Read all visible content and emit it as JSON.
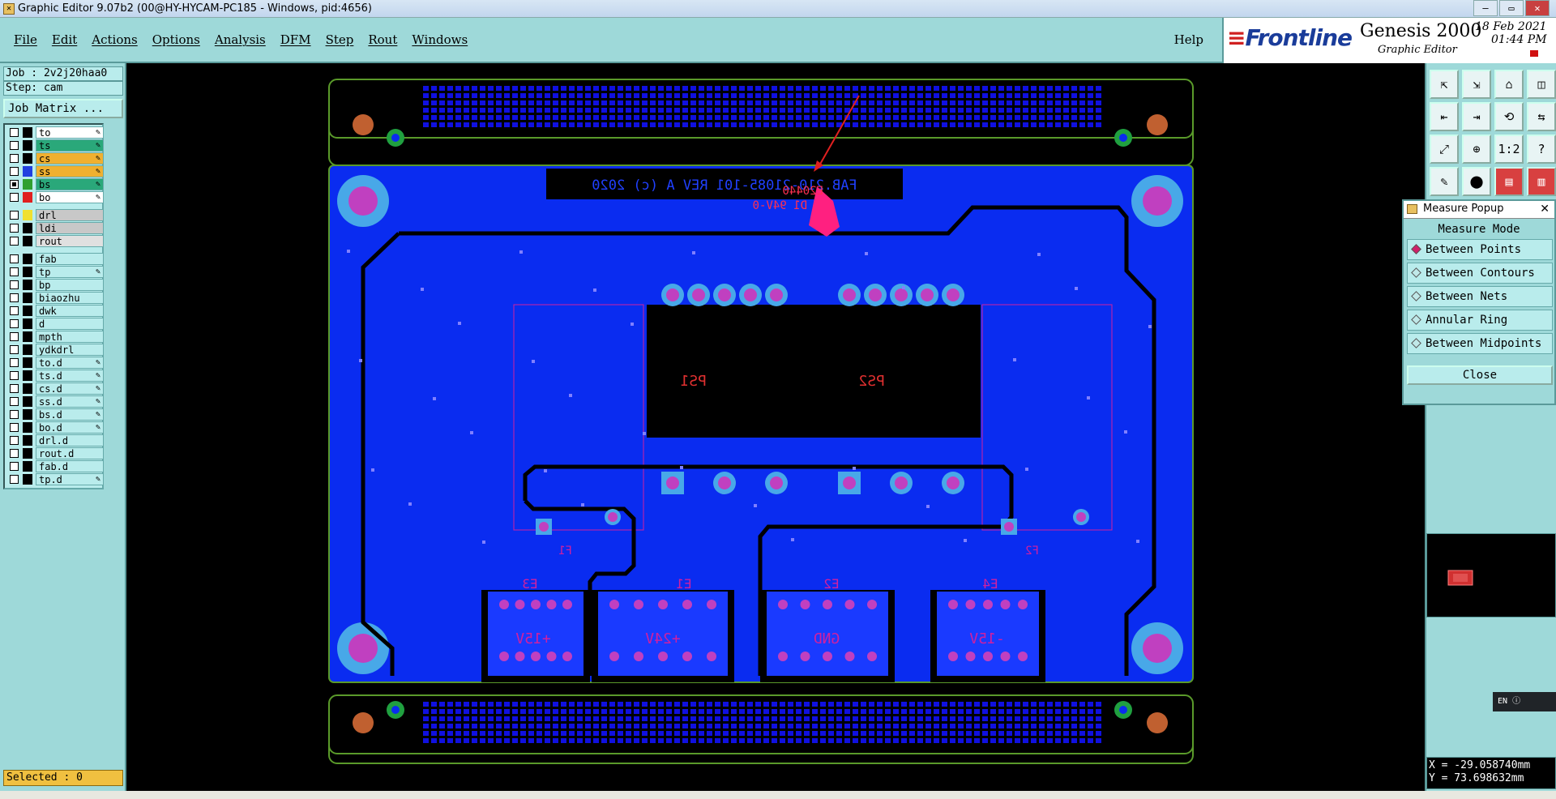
{
  "window": {
    "title": "Graphic Editor 9.07b2 (00@HY-HYCAM-PC185 - Windows, pid:4656)",
    "minimize_glyph": "—",
    "maximize_glyph": "▭",
    "close_glyph": "✕"
  },
  "menu": {
    "items": [
      "File",
      "Edit",
      "Actions",
      "Options",
      "Analysis",
      "DFM",
      "Step",
      "Rout",
      "Windows"
    ],
    "help": "Help"
  },
  "brand": {
    "logo": "Frontline",
    "product": "Genesis 2000",
    "subtitle": "Graphic Editor",
    "date": "18 Feb 2021",
    "time": "01:44 PM"
  },
  "job": {
    "job_label": "Job : 2v2j20haa0",
    "step_label": "Step: cam",
    "matrix_button": "Job Matrix ..."
  },
  "layers": [
    {
      "name": "to",
      "bg": "#ffffff",
      "swatch": "#000000",
      "checked": false,
      "edit": true
    },
    {
      "name": "ts",
      "bg": "#2aa87a",
      "swatch": "#000000",
      "checked": false,
      "edit": true
    },
    {
      "name": "cs",
      "bg": "#f0b030",
      "swatch": "#000000",
      "checked": false,
      "edit": true
    },
    {
      "name": "ss",
      "bg": "#f0b030",
      "swatch": "#2040e0",
      "checked": false,
      "edit": true
    },
    {
      "name": "bs",
      "bg": "#2aa87a",
      "swatch": "#30a030",
      "checked": true,
      "edit": true
    },
    {
      "name": "bo",
      "bg": "#ffffff",
      "swatch": "#e02020",
      "checked": false,
      "edit": true
    },
    {
      "name": "drl",
      "bg": "#c8c8c8",
      "swatch": "#f0e030",
      "checked": false,
      "edit": false
    },
    {
      "name": "ldi",
      "bg": "#c8c8c8",
      "swatch": "#000000",
      "checked": false,
      "edit": false
    },
    {
      "name": "rout",
      "bg": "#e0e0e0",
      "swatch": "#000000",
      "checked": false,
      "edit": false
    },
    {
      "name": "fab",
      "bg": "#b9ecec",
      "swatch": "#000000",
      "checked": false,
      "edit": false
    },
    {
      "name": "tp",
      "bg": "#b9ecec",
      "swatch": "#000000",
      "checked": false,
      "edit": true
    },
    {
      "name": "bp",
      "bg": "#b9ecec",
      "swatch": "#000000",
      "checked": false,
      "edit": false
    },
    {
      "name": "biaozhu",
      "bg": "#b9ecec",
      "swatch": "#000000",
      "checked": false,
      "edit": false
    },
    {
      "name": "dwk",
      "bg": "#b9ecec",
      "swatch": "#000000",
      "checked": false,
      "edit": false
    },
    {
      "name": "d",
      "bg": "#b9ecec",
      "swatch": "#000000",
      "checked": false,
      "edit": false
    },
    {
      "name": "mpth",
      "bg": "#b9ecec",
      "swatch": "#000000",
      "checked": false,
      "edit": false
    },
    {
      "name": "ydkdrl",
      "bg": "#b9ecec",
      "swatch": "#000000",
      "checked": false,
      "edit": false
    },
    {
      "name": "to.d",
      "bg": "#b9ecec",
      "swatch": "#000000",
      "checked": false,
      "edit": true
    },
    {
      "name": "ts.d",
      "bg": "#b9ecec",
      "swatch": "#000000",
      "checked": false,
      "edit": true
    },
    {
      "name": "cs.d",
      "bg": "#b9ecec",
      "swatch": "#000000",
      "checked": false,
      "edit": true
    },
    {
      "name": "ss.d",
      "bg": "#b9ecec",
      "swatch": "#000000",
      "checked": false,
      "edit": true
    },
    {
      "name": "bs.d",
      "bg": "#b9ecec",
      "swatch": "#000000",
      "checked": false,
      "edit": true
    },
    {
      "name": "bo.d",
      "bg": "#b9ecec",
      "swatch": "#000000",
      "checked": false,
      "edit": true
    },
    {
      "name": "drl.d",
      "bg": "#b9ecec",
      "swatch": "#000000",
      "checked": false,
      "edit": false
    },
    {
      "name": "rout.d",
      "bg": "#b9ecec",
      "swatch": "#000000",
      "checked": false,
      "edit": false
    },
    {
      "name": "fab.d",
      "bg": "#b9ecec",
      "swatch": "#000000",
      "checked": false,
      "edit": false
    },
    {
      "name": "tp.d",
      "bg": "#b9ecec",
      "swatch": "#000000",
      "checked": false,
      "edit": true
    }
  ],
  "status": {
    "selected": "Selected : 0"
  },
  "board": {
    "fab_text": "FAB.210-21085-101 REV A (c) 2020",
    "marking_1": "E20440",
    "marking_2": "D1 94V-0",
    "ps1": "PS1",
    "ps2": "PS2",
    "f1": "F1",
    "f2": "F2",
    "e1": "E1",
    "e2": "E2",
    "e3": "E3",
    "e4": "E4",
    "v24": "+24V",
    "gnd": "GND",
    "v15p": "+15V",
    "v15n": "-15V"
  },
  "colors": {
    "board": "#0a2cf0",
    "pad_fill": "#c040c0",
    "pad_ring": "#48a8e8",
    "outline": "#5a9a2a",
    "trace": "#000000",
    "silk": "#d020a0"
  },
  "toolbar_icons": [
    "home-top-icon",
    "home-bottom-icon",
    "house-icon",
    "window-icon",
    "pan-left-icon",
    "pan-right-icon",
    "snap-icon",
    "swap-icon",
    "zoom-fit-icon",
    "zoom-center-icon",
    "scale-icon",
    "query-icon",
    "draw-icon",
    "feature-icon",
    "layer-red-icon",
    "layer-red2-icon"
  ],
  "toolbar_glyphs": [
    "⇱",
    "⇲",
    "⌂",
    "◫",
    "⇤",
    "⇥",
    "⟲",
    "⇆",
    "⤢",
    "⊕",
    "1:2",
    "?",
    "✎",
    "⬤",
    "▤",
    "▥"
  ],
  "toolbar_labels": [
    "",
    "",
    "",
    "",
    "",
    "",
    "",
    "",
    "",
    "",
    "1:2",
    "",
    "",
    "",
    "",
    ""
  ],
  "measure": {
    "title": "Measure Popup",
    "mode_label": "Measure Mode",
    "options": [
      "Between Points",
      "Between Contours",
      "Between Nets",
      "Annular Ring",
      "Between Midpoints"
    ],
    "selected_index": 0,
    "close": "Close"
  },
  "coords": {
    "x": "X = -29.058740mm",
    "y": "Y = 73.698632mm"
  },
  "lang": {
    "code": "EN"
  }
}
